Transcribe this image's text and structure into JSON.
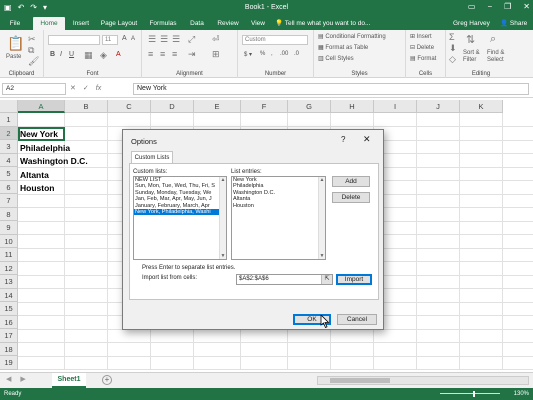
{
  "window": {
    "title": "Book1 - Excel"
  },
  "tabs": {
    "file": "File",
    "home": "Home",
    "insert": "Insert",
    "page_layout": "Page Layout",
    "formulas": "Formulas",
    "data": "Data",
    "review": "Review",
    "view": "View",
    "tell_me": "Tell me what you want to do...",
    "user": "Greg Harvey",
    "share": "Share"
  },
  "ribbon": {
    "clipboard_label": "Clipboard",
    "paste": "Paste",
    "font_label": "Font",
    "font_size": "11",
    "alignment_label": "Alignment",
    "number_label": "Number",
    "number_format": "Custom",
    "styles_label": "Styles",
    "conditional_formatting": "Conditional Formatting",
    "format_as_table": "Format as Table",
    "cell_styles": "Cell Styles",
    "cells_label": "Cells",
    "insert": "Insert",
    "delete": "Delete",
    "format": "Format",
    "editing_label": "Editing",
    "sort_filter": "Sort & Filter",
    "find_select": "Find & Select"
  },
  "formula_bar": {
    "name_box": "A2",
    "formula": "New York"
  },
  "grid": {
    "columns": [
      "A",
      "B",
      "C",
      "D",
      "E",
      "F",
      "G",
      "H",
      "I",
      "J",
      "K"
    ],
    "rows": [
      "1",
      "2",
      "3",
      "4",
      "5",
      "6",
      "7",
      "8",
      "9",
      "10",
      "11",
      "12",
      "13",
      "14",
      "15",
      "16",
      "17",
      "18",
      "19"
    ],
    "cells": [
      "New York",
      "Philadelphia",
      "Washington D.C.",
      "Altanta",
      "Houston"
    ]
  },
  "sheets": {
    "active": "Sheet1"
  },
  "status": {
    "ready": "Ready",
    "zoom": "130%"
  },
  "dialog": {
    "title": "Options",
    "help": "?",
    "close": "✕",
    "tab": "Custom Lists",
    "custom_lists_label": "Custom lists:",
    "custom_lists": [
      "NEW LIST",
      "Sun, Mon, Tue, Wed, Thu, Fri, S",
      "Sunday, Monday, Tuesday, We",
      "Jan, Feb, Mar, Apr, May, Jun, J",
      "January, February, March, Apr",
      "New York, Philadelphia, Washi"
    ],
    "list_entries_label": "List entries:",
    "list_entries": [
      "New York",
      "Philadelphia",
      "Washington D.C.",
      "Altanta",
      "Houston"
    ],
    "add_button": "Add",
    "delete_button": "Delete",
    "enter_hint": "Press Enter to separate list entries.",
    "import_label": "Import list from cells:",
    "import_range": "$A$2:$A$6",
    "import_button": "Import",
    "ok_button": "OK",
    "cancel_button": "Cancel"
  }
}
